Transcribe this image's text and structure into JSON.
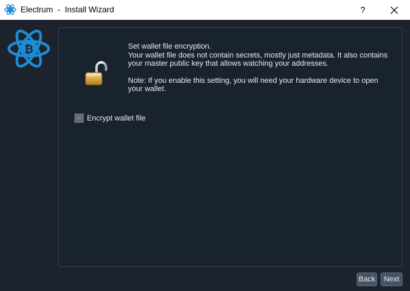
{
  "window": {
    "app_name": "Electrum",
    "separator": "-",
    "title": "Install Wizard",
    "title_full": "Electrum  -  Install Wizard",
    "help_label": "?",
    "close_label": "✕"
  },
  "icons": {
    "app": "electrum-atom-icon",
    "logo": "electrum-bitcoin-logo",
    "lock": "open-padlock-icon",
    "close": "close-icon",
    "help": "help-icon"
  },
  "colors": {
    "background": "#1c232c",
    "panel": "#19232d",
    "logo_blue": "#1f8bd4",
    "button": "#455364",
    "text": "#e8ecef"
  },
  "message": {
    "line1": "Set wallet file encryption.",
    "line2": "Your wallet file does not contain secrets, mostly just metadata. It also contains",
    "line3": "your master public key that allows watching your addresses.",
    "line4": "Note: If you enable this setting, you will need your hardware device to open",
    "line5": "your wallet."
  },
  "encrypt": {
    "label": "Encrypt wallet file",
    "checked": false
  },
  "buttons": {
    "back": "Back",
    "next": "Next"
  }
}
